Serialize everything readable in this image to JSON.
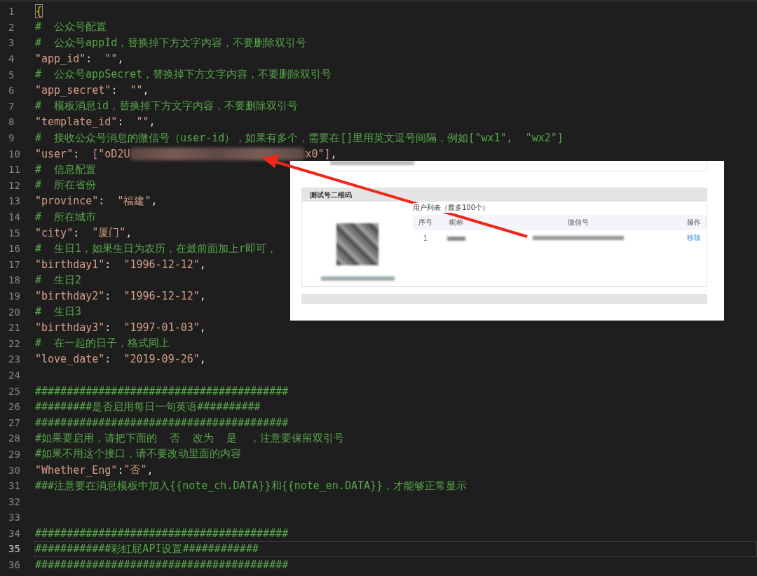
{
  "editor": {
    "lines": [
      {
        "number": "1",
        "current": false,
        "tokens": [
          {
            "kind": "brace-match",
            "text": "{"
          }
        ]
      },
      {
        "number": "2",
        "current": false,
        "tokens": [
          {
            "kind": "comment",
            "text": "#  公众号配置"
          }
        ]
      },
      {
        "number": "3",
        "current": false,
        "tokens": [
          {
            "kind": "comment",
            "text": "#  公众号appId，替换掉下方文字内容，不要删除双引号"
          }
        ]
      },
      {
        "number": "4",
        "current": false,
        "tokens": [
          {
            "kind": "string",
            "text": "\"app_id\""
          },
          {
            "kind": "punct",
            "text": ":  "
          },
          {
            "kind": "string",
            "text": "\"\""
          },
          {
            "kind": "punct",
            "text": ","
          }
        ]
      },
      {
        "number": "5",
        "current": false,
        "tokens": [
          {
            "kind": "comment",
            "text": "#  公众号appSecret，替换掉下方文字内容，不要删除双引号"
          }
        ]
      },
      {
        "number": "6",
        "current": false,
        "tokens": [
          {
            "kind": "string",
            "text": "\"app_secret\""
          },
          {
            "kind": "punct",
            "text": ":  "
          },
          {
            "kind": "string",
            "text": "\"\""
          },
          {
            "kind": "punct",
            "text": ","
          }
        ]
      },
      {
        "number": "7",
        "current": false,
        "tokens": [
          {
            "kind": "comment",
            "text": "#  模板消息id，替换掉下方文字内容，不要删除双引号"
          }
        ]
      },
      {
        "number": "8",
        "current": false,
        "tokens": [
          {
            "kind": "string",
            "text": "\"template_id\""
          },
          {
            "kind": "punct",
            "text": ":  "
          },
          {
            "kind": "string",
            "text": "\"\""
          },
          {
            "kind": "punct",
            "text": ","
          }
        ]
      },
      {
        "number": "9",
        "current": false,
        "tokens": [
          {
            "kind": "comment",
            "text": "#  接收公众号消息的微信号（user-id），如果有多个，需要在[]里用英文逗号间隔，例如[\"wx1\",  \"wx2\"]"
          }
        ]
      },
      {
        "number": "10",
        "current": false,
        "tokens": [
          {
            "kind": "string",
            "text": "\"user\""
          },
          {
            "kind": "punct",
            "text": ":  "
          },
          {
            "kind": "bracket",
            "text": "["
          },
          {
            "kind": "string",
            "text": "\"oD2U"
          },
          {
            "kind": "redacted"
          },
          {
            "kind": "string",
            "text": "x0\""
          },
          {
            "kind": "bracket",
            "text": "]"
          },
          {
            "kind": "punct",
            "text": ","
          }
        ]
      },
      {
        "number": "11",
        "current": false,
        "tokens": [
          {
            "kind": "comment",
            "text": "#  信息配置"
          }
        ]
      },
      {
        "number": "12",
        "current": false,
        "tokens": [
          {
            "kind": "comment",
            "text": "#  所在省份"
          }
        ]
      },
      {
        "number": "13",
        "current": false,
        "tokens": [
          {
            "kind": "string",
            "text": "\"province\""
          },
          {
            "kind": "punct",
            "text": ":  "
          },
          {
            "kind": "string",
            "text": "\"福建\""
          },
          {
            "kind": "punct",
            "text": ","
          }
        ]
      },
      {
        "number": "14",
        "current": false,
        "tokens": [
          {
            "kind": "comment",
            "text": "#  所在城市"
          }
        ]
      },
      {
        "number": "15",
        "current": false,
        "tokens": [
          {
            "kind": "string",
            "text": "\"city\""
          },
          {
            "kind": "punct",
            "text": ":  "
          },
          {
            "kind": "string",
            "text": "\"厦门\""
          },
          {
            "kind": "punct",
            "text": ","
          }
        ]
      },
      {
        "number": "16",
        "current": false,
        "tokens": [
          {
            "kind": "comment",
            "text": "#  生日1，如果生日为农历，在最前面加上r即可，"
          }
        ]
      },
      {
        "number": "17",
        "current": false,
        "tokens": [
          {
            "kind": "string",
            "text": "\"birthday1\""
          },
          {
            "kind": "punct",
            "text": ":  "
          },
          {
            "kind": "string",
            "text": "\"1996-12-12\""
          },
          {
            "kind": "punct",
            "text": ","
          }
        ]
      },
      {
        "number": "18",
        "current": false,
        "tokens": [
          {
            "kind": "comment",
            "text": "#  生日2"
          }
        ]
      },
      {
        "number": "19",
        "current": false,
        "tokens": [
          {
            "kind": "string",
            "text": "\"birthday2\""
          },
          {
            "kind": "punct",
            "text": ":  "
          },
          {
            "kind": "string",
            "text": "\"1996-12-12\""
          },
          {
            "kind": "punct",
            "text": ","
          }
        ]
      },
      {
        "number": "20",
        "current": false,
        "tokens": [
          {
            "kind": "comment",
            "text": "#  生日3"
          }
        ]
      },
      {
        "number": "21",
        "current": false,
        "tokens": [
          {
            "kind": "string",
            "text": "\"birthday3\""
          },
          {
            "kind": "punct",
            "text": ":  "
          },
          {
            "kind": "string",
            "text": "\"1997-01-03\""
          },
          {
            "kind": "punct",
            "text": ","
          }
        ]
      },
      {
        "number": "22",
        "current": false,
        "tokens": [
          {
            "kind": "comment",
            "text": "#  在一起的日子，格式同上"
          }
        ]
      },
      {
        "number": "23",
        "current": false,
        "tokens": [
          {
            "kind": "string",
            "text": "\"love_date\""
          },
          {
            "kind": "punct",
            "text": ":  "
          },
          {
            "kind": "string",
            "text": "\"2019-09-26\""
          },
          {
            "kind": "punct",
            "text": ","
          }
        ]
      },
      {
        "number": "24",
        "current": false
      },
      {
        "number": "25",
        "current": false,
        "tokens": [
          {
            "kind": "comment",
            "text": "########################################"
          }
        ]
      },
      {
        "number": "26",
        "current": false,
        "tokens": [
          {
            "kind": "comment",
            "text": "#########是否启用每日一句英语##########"
          }
        ]
      },
      {
        "number": "27",
        "current": false,
        "tokens": [
          {
            "kind": "comment",
            "text": "########################################"
          }
        ]
      },
      {
        "number": "28",
        "current": false,
        "tokens": [
          {
            "kind": "comment",
            "text": "#如果要启用，请把下面的  否  改为  是  ，注意要保留双引号"
          }
        ]
      },
      {
        "number": "29",
        "current": false,
        "tokens": [
          {
            "kind": "comment",
            "text": "#如果不用这个接口，请不要改动里面的内容"
          }
        ]
      },
      {
        "number": "30",
        "current": false,
        "tokens": [
          {
            "kind": "string",
            "text": "\"Whether_Eng\""
          },
          {
            "kind": "punct",
            "text": ":"
          },
          {
            "kind": "string",
            "text": "\"否\""
          },
          {
            "kind": "punct",
            "text": ","
          }
        ]
      },
      {
        "number": "31",
        "current": false,
        "tokens": [
          {
            "kind": "comment",
            "text": "###注意要在消息模板中加入{{note_ch.DATA}}和{{note_en.DATA}}，才能够正常显示"
          }
        ]
      },
      {
        "number": "32",
        "current": false
      },
      {
        "number": "33",
        "current": false
      },
      {
        "number": "34",
        "current": false,
        "tokens": [
          {
            "kind": "comment",
            "text": "########################################"
          }
        ]
      },
      {
        "number": "35",
        "current": true,
        "tokens": [
          {
            "kind": "comment",
            "text": "############彩虹屁API设置############"
          }
        ]
      },
      {
        "number": "36",
        "current": false,
        "tokens": [
          {
            "kind": "comment",
            "text": "########################################"
          }
        ]
      }
    ]
  },
  "inset": {
    "section_title": "测试号二维码",
    "list_title": "用户列表（最多100个）",
    "columns": [
      "序号",
      "昵称",
      "微信号",
      "操作"
    ],
    "rows": [
      {
        "number": "1",
        "action": "移除"
      }
    ]
  }
}
